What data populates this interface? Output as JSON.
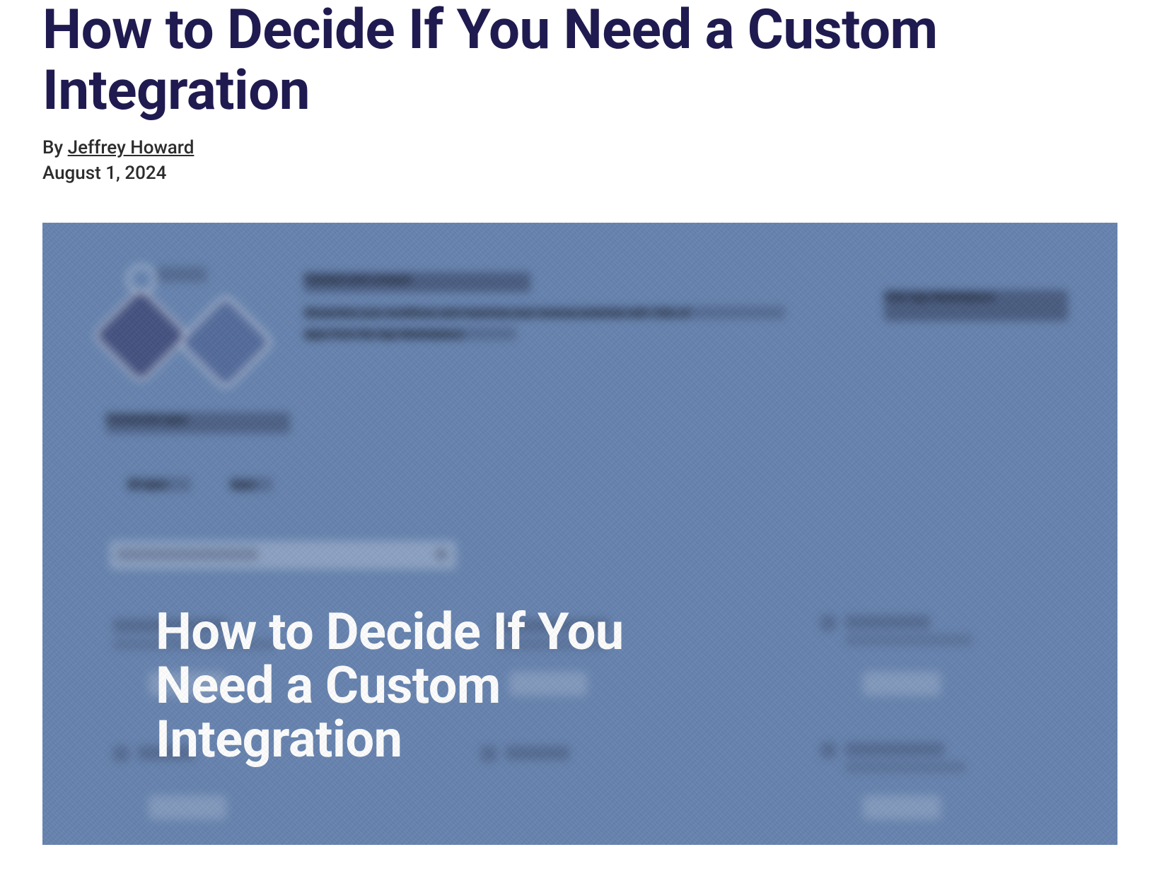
{
  "article": {
    "title": "How to Decide If You Need a Custom Integration",
    "byline_prefix": "By ",
    "author": "Jeffrey Howard",
    "date": "August 1, 2024"
  },
  "hero": {
    "overlay_title": "How to Decide If You Need a Custom Integration",
    "bg": {
      "heading": "Connect and conquer",
      "sub1": "Streamline your workflows and maximize your revenue potential with 100s of",
      "sub2": "apps from the App Marketplace.",
      "cta": "Visit App Marketplace",
      "section": "Connected apps",
      "tab1": "All apps",
      "tab2": "Apps",
      "search_placeholder": "Search for an app"
    }
  }
}
